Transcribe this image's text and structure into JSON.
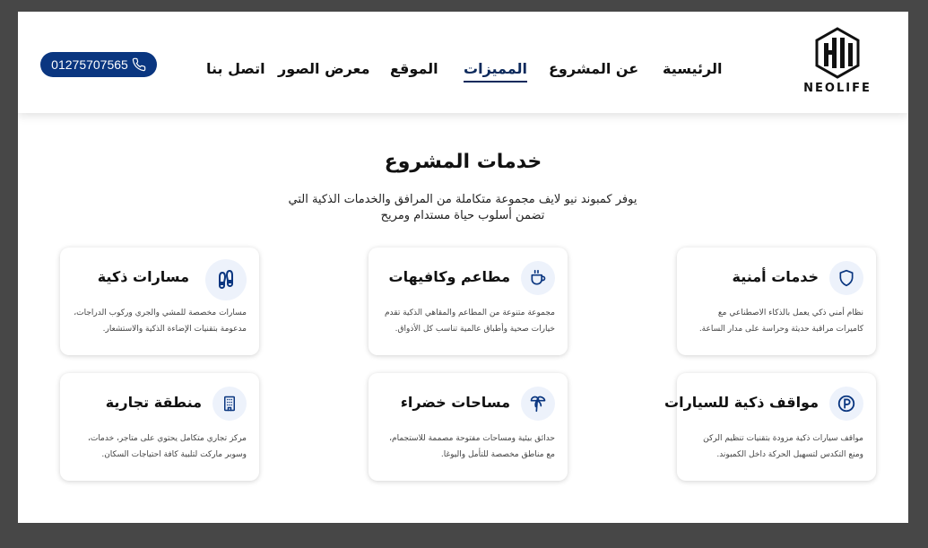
{
  "brand": {
    "name": "NEOLIFE"
  },
  "nav": {
    "items": [
      {
        "label": "الرئيسية",
        "active": false
      },
      {
        "label": "عن المشروع",
        "active": false
      },
      {
        "label": "المميزات",
        "active": true
      },
      {
        "label": "الموقع",
        "active": false
      },
      {
        "label": "معرض الصور",
        "active": false
      },
      {
        "label": "اتصل بنا",
        "active": false
      }
    ],
    "phone": "01275707565",
    "phone_icon": "phone-icon"
  },
  "services": {
    "title": "خدمات المشروع",
    "description": "يوفر كمبوند نيو لايف مجموعة متكاملة من المرافق والخدمات الذكية التي تضمن أسلوب حياة مستدام ومريح",
    "cards": [
      {
        "icon": "shield-icon",
        "title": "خدمات أمنية",
        "desc": "نظام أمني ذكي يعمل بالذكاء الاصطناعي مع كاميرات مراقبة حديثة وحراسة على مدار الساعة."
      },
      {
        "icon": "coffee-cup-icon",
        "title": "مطاعم وكافيهات",
        "desc": "مجموعة متنوعة من المطاعم والمقاهي الذكية تقدم خيارات صحية وأطباق عالمية تناسب كل الأذواق."
      },
      {
        "icon": "footprints-icon",
        "title": "مسارات ذكية",
        "desc": "مسارات مخصصة للمشي والجري وركوب الدراجات، مدعومة بتقنيات الإضاءة الذكية والاستشعار."
      },
      {
        "icon": "parking-icon",
        "title": "مواقف ذكية للسيارات",
        "desc": "مواقف سيارات ذكية مزودة بتقنيات تنظيم الركن ومنع التكدس لتسهيل الحركة داخل الكمبوند."
      },
      {
        "icon": "palm-tree-icon",
        "title": "مساحات خضراء",
        "desc": "حدائق بيئية ومساحات مفتوحة مصممة للاستجمام، مع مناطق مخصصة للتأمل واليوغا."
      },
      {
        "icon": "building-icon",
        "title": "منطقة تجارية",
        "desc": "مركز تجاري متكامل يحتوي على متاجر، خدمات، وسوبر ماركت لتلبية كافة احتياجات السكان."
      }
    ]
  },
  "colors": {
    "accent": "#0a3680",
    "page_bg": "#474747",
    "icon_bg": "#edf2fb"
  }
}
